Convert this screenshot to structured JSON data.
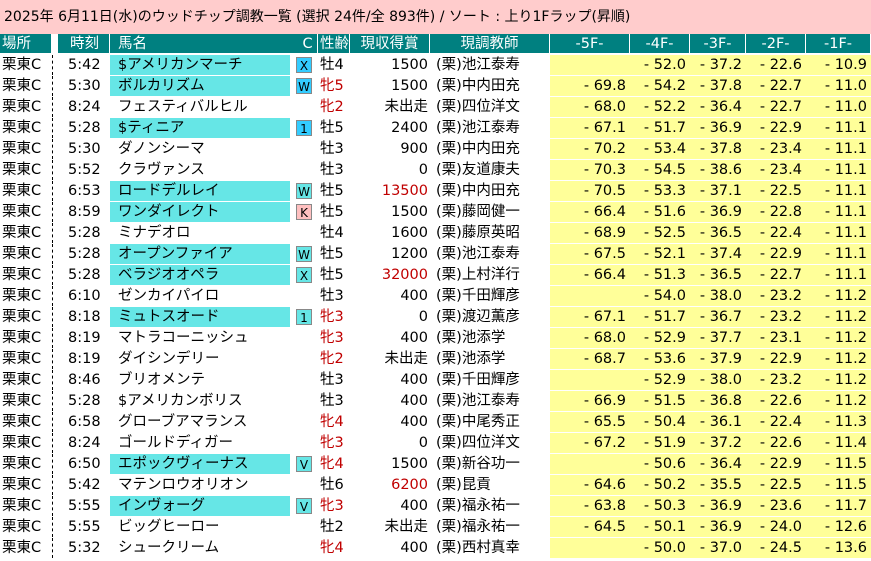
{
  "title": "2025年 6月11日(水)のウッドチップ調教一覧 (選択 24件/全 893件)  /  ソート : 上り1Fラップ(昇順)",
  "headers": [
    "場所",
    "時刻",
    "馬名",
    "C",
    "性齢",
    "現収得賞",
    "現調教師",
    "-5F-",
    "-4F-",
    "-3F-",
    "-2F-",
    "-1F-"
  ],
  "colors": {
    "header_bg": "#008080",
    "title_bg": "#ffcccc",
    "lap_bg": "#ffff99",
    "highlight": "#66e6e6",
    "female_text": "#c00000"
  },
  "rows": [
    {
      "place": "栗東C",
      "time": "5:42",
      "horse": "$アメリカンマーチ",
      "hl": true,
      "badge": "X",
      "badge_color": "blue",
      "sex": "牡4",
      "female": false,
      "prize": "1500",
      "prize_red": false,
      "trainer": "(栗)池江泰寿",
      "r5": "",
      "r4": "- 52.0",
      "r3": "- 37.2",
      "r2": "- 22.6",
      "r1": "- 10.9"
    },
    {
      "place": "栗東C",
      "time": "5:30",
      "horse": "ボルカリズム",
      "hl": true,
      "badge": "W",
      "badge_color": "blue",
      "sex": "牝5",
      "female": true,
      "prize": "1500",
      "prize_red": false,
      "trainer": "(栗)中内田充",
      "r5": "- 69.8",
      "r4": "- 54.2",
      "r3": "- 37.8",
      "r2": "- 22.7",
      "r1": "- 11.0"
    },
    {
      "place": "栗東C",
      "time": "8:24",
      "horse": "フェスティバルヒル",
      "hl": false,
      "badge": "",
      "badge_color": "",
      "sex": "牝2",
      "female": true,
      "prize": "未出走",
      "prize_red": false,
      "trainer": "(栗)四位洋文",
      "r5": "- 68.0",
      "r4": "- 52.2",
      "r3": "- 36.4",
      "r2": "- 22.7",
      "r1": "- 11.0"
    },
    {
      "place": "栗東C",
      "time": "5:28",
      "horse": "$ティニア",
      "hl": true,
      "badge": "1",
      "badge_color": "blue",
      "sex": "牡5",
      "female": false,
      "prize": "2400",
      "prize_red": false,
      "trainer": "(栗)池江泰寿",
      "r5": "- 67.1",
      "r4": "- 51.7",
      "r3": "- 36.9",
      "r2": "- 22.9",
      "r1": "- 11.1"
    },
    {
      "place": "栗東C",
      "time": "5:30",
      "horse": "ダノンシーマ",
      "hl": false,
      "badge": "",
      "badge_color": "",
      "sex": "牡3",
      "female": false,
      "prize": "900",
      "prize_red": false,
      "trainer": "(栗)中内田充",
      "r5": "- 70.2",
      "r4": "- 53.4",
      "r3": "- 37.8",
      "r2": "- 23.4",
      "r1": "- 11.1"
    },
    {
      "place": "栗東C",
      "time": "5:52",
      "horse": "クラヴァンス",
      "hl": false,
      "badge": "",
      "badge_color": "",
      "sex": "牡3",
      "female": false,
      "prize": "0",
      "prize_red": false,
      "trainer": "(栗)友道康夫",
      "r5": "- 70.3",
      "r4": "- 54.5",
      "r3": "- 38.6",
      "r2": "- 23.4",
      "r1": "- 11.1"
    },
    {
      "place": "栗東C",
      "time": "6:53",
      "horse": "ロードデルレイ",
      "hl": true,
      "badge": "W",
      "badge_color": "green",
      "sex": "牡5",
      "female": false,
      "prize": "13500",
      "prize_red": true,
      "trainer": "(栗)中内田充",
      "r5": "- 70.5",
      "r4": "- 53.3",
      "r3": "- 37.1",
      "r2": "- 22.5",
      "r1": "- 11.1"
    },
    {
      "place": "栗東C",
      "time": "8:59",
      "horse": "ワンダイレクト",
      "hl": true,
      "badge": "K",
      "badge_color": "red",
      "sex": "牡5",
      "female": false,
      "prize": "1500",
      "prize_red": false,
      "trainer": "(栗)藤岡健一",
      "r5": "- 66.4",
      "r4": "- 51.6",
      "r3": "- 36.9",
      "r2": "- 22.8",
      "r1": "- 11.1"
    },
    {
      "place": "栗東C",
      "time": "5:28",
      "horse": "ミナデオロ",
      "hl": false,
      "badge": "",
      "badge_color": "",
      "sex": "牡4",
      "female": false,
      "prize": "1600",
      "prize_red": false,
      "trainer": "(栗)藤原英昭",
      "r5": "- 68.9",
      "r4": "- 52.5",
      "r3": "- 36.5",
      "r2": "- 22.4",
      "r1": "- 11.1"
    },
    {
      "place": "栗東C",
      "time": "5:28",
      "horse": "オープンファイア",
      "hl": true,
      "badge": "W",
      "badge_color": "green",
      "sex": "牡5",
      "female": false,
      "prize": "1200",
      "prize_red": false,
      "trainer": "(栗)池江泰寿",
      "r5": "- 67.5",
      "r4": "- 52.1",
      "r3": "- 37.4",
      "r2": "- 22.9",
      "r1": "- 11.1"
    },
    {
      "place": "栗東C",
      "time": "5:28",
      "horse": "ベラジオオペラ",
      "hl": true,
      "badge": "X",
      "badge_color": "green",
      "sex": "牡5",
      "female": false,
      "prize": "32000",
      "prize_red": true,
      "trainer": "(栗)上村洋行",
      "r5": "- 66.4",
      "r4": "- 51.3",
      "r3": "- 36.5",
      "r2": "- 22.7",
      "r1": "- 11.1"
    },
    {
      "place": "栗東C",
      "time": "6:10",
      "horse": "ゼンカイパイロ",
      "hl": false,
      "badge": "",
      "badge_color": "",
      "sex": "牡3",
      "female": false,
      "prize": "400",
      "prize_red": false,
      "trainer": "(栗)千田輝彦",
      "r5": "",
      "r4": "- 54.0",
      "r3": "- 38.0",
      "r2": "- 23.2",
      "r1": "- 11.2"
    },
    {
      "place": "栗東C",
      "time": "8:18",
      "horse": "ミュトスオード",
      "hl": true,
      "badge": "1",
      "badge_color": "green",
      "sex": "牝3",
      "female": true,
      "prize": "0",
      "prize_red": false,
      "trainer": "(栗)渡辺薫彦",
      "r5": "- 67.1",
      "r4": "- 51.7",
      "r3": "- 36.7",
      "r2": "- 23.2",
      "r1": "- 11.2"
    },
    {
      "place": "栗東C",
      "time": "8:19",
      "horse": "マトラコーニッシュ",
      "hl": false,
      "badge": "",
      "badge_color": "",
      "sex": "牝3",
      "female": true,
      "prize": "400",
      "prize_red": false,
      "trainer": "(栗)池添学",
      "r5": "- 68.0",
      "r4": "- 52.9",
      "r3": "- 37.7",
      "r2": "- 23.1",
      "r1": "- 11.2"
    },
    {
      "place": "栗東C",
      "time": "8:19",
      "horse": "ダイシンデリー",
      "hl": false,
      "badge": "",
      "badge_color": "",
      "sex": "牝2",
      "female": true,
      "prize": "未出走",
      "prize_red": false,
      "trainer": "(栗)池添学",
      "r5": "- 68.7",
      "r4": "- 53.6",
      "r3": "- 37.9",
      "r2": "- 22.9",
      "r1": "- 11.2"
    },
    {
      "place": "栗東C",
      "time": "8:46",
      "horse": "ブリオメンテ",
      "hl": false,
      "badge": "",
      "badge_color": "",
      "sex": "牡3",
      "female": false,
      "prize": "400",
      "prize_red": false,
      "trainer": "(栗)千田輝彦",
      "r5": "",
      "r4": "- 52.9",
      "r3": "- 38.0",
      "r2": "- 23.2",
      "r1": "- 11.2"
    },
    {
      "place": "栗東C",
      "time": "5:28",
      "horse": "$アメリカンボリス",
      "hl": false,
      "badge": "",
      "badge_color": "",
      "sex": "牡3",
      "female": false,
      "prize": "400",
      "prize_red": false,
      "trainer": "(栗)池江泰寿",
      "r5": "- 66.9",
      "r4": "- 51.5",
      "r3": "- 36.8",
      "r2": "- 22.6",
      "r1": "- 11.2"
    },
    {
      "place": "栗東C",
      "time": "6:58",
      "horse": "グローブアマランス",
      "hl": false,
      "badge": "",
      "badge_color": "",
      "sex": "牝4",
      "female": true,
      "prize": "400",
      "prize_red": false,
      "trainer": "(栗)中尾秀正",
      "r5": "- 65.5",
      "r4": "- 50.4",
      "r3": "- 36.1",
      "r2": "- 22.4",
      "r1": "- 11.3"
    },
    {
      "place": "栗東C",
      "time": "8:24",
      "horse": "ゴールドディガー",
      "hl": false,
      "badge": "",
      "badge_color": "",
      "sex": "牝3",
      "female": true,
      "prize": "0",
      "prize_red": false,
      "trainer": "(栗)四位洋文",
      "r5": "- 67.2",
      "r4": "- 51.9",
      "r3": "- 37.2",
      "r2": "- 22.6",
      "r1": "- 11.4"
    },
    {
      "place": "栗東C",
      "time": "6:50",
      "horse": "エポックヴィーナス",
      "hl": true,
      "badge": "V",
      "badge_color": "green",
      "sex": "牝4",
      "female": true,
      "prize": "1500",
      "prize_red": false,
      "trainer": "(栗)新谷功一",
      "r5": "",
      "r4": "- 50.6",
      "r3": "- 36.4",
      "r2": "- 22.9",
      "r1": "- 11.5"
    },
    {
      "place": "栗東C",
      "time": "5:42",
      "horse": "マテンロウオリオン",
      "hl": false,
      "badge": "",
      "badge_color": "",
      "sex": "牡6",
      "female": false,
      "prize": "6200",
      "prize_red": true,
      "trainer": "(栗)昆貢",
      "r5": "- 64.6",
      "r4": "- 50.2",
      "r3": "- 35.5",
      "r2": "- 22.5",
      "r1": "- 11.5"
    },
    {
      "place": "栗東C",
      "time": "5:55",
      "horse": "インヴォーグ",
      "hl": true,
      "badge": "V",
      "badge_color": "green",
      "sex": "牝3",
      "female": true,
      "prize": "400",
      "prize_red": false,
      "trainer": "(栗)福永祐一",
      "r5": "- 63.8",
      "r4": "- 50.3",
      "r3": "- 36.9",
      "r2": "- 23.6",
      "r1": "- 11.7"
    },
    {
      "place": "栗東C",
      "time": "5:55",
      "horse": "ビッグヒーロー",
      "hl": false,
      "badge": "",
      "badge_color": "",
      "sex": "牡2",
      "female": false,
      "prize": "未出走",
      "prize_red": false,
      "trainer": "(栗)福永祐一",
      "r5": "- 64.5",
      "r4": "- 50.1",
      "r3": "- 36.9",
      "r2": "- 24.0",
      "r1": "- 12.6"
    },
    {
      "place": "栗東C",
      "time": "5:32",
      "horse": "シュークリーム",
      "hl": false,
      "badge": "",
      "badge_color": "",
      "sex": "牝4",
      "female": true,
      "prize": "400",
      "prize_red": false,
      "trainer": "(栗)西村真幸",
      "r5": "",
      "r4": "- 50.0",
      "r3": "- 37.0",
      "r2": "- 24.5",
      "r1": "- 13.6"
    }
  ]
}
